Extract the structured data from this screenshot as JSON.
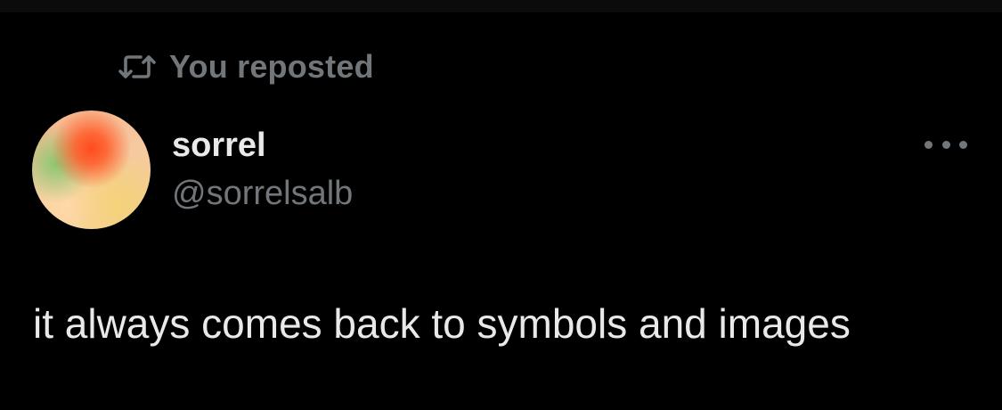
{
  "repost": {
    "label": "You reposted",
    "icon": "repost-icon"
  },
  "author": {
    "display_name": "sorrel",
    "handle": "@sorrelsalb",
    "avatar": "avatar"
  },
  "menu": {
    "icon": "more-horizontal-icon"
  },
  "post": {
    "text": "it always comes back to symbols and images"
  },
  "colors": {
    "background": "#000000",
    "primary_text": "#e7e9ea",
    "secondary_text": "#71767b"
  }
}
